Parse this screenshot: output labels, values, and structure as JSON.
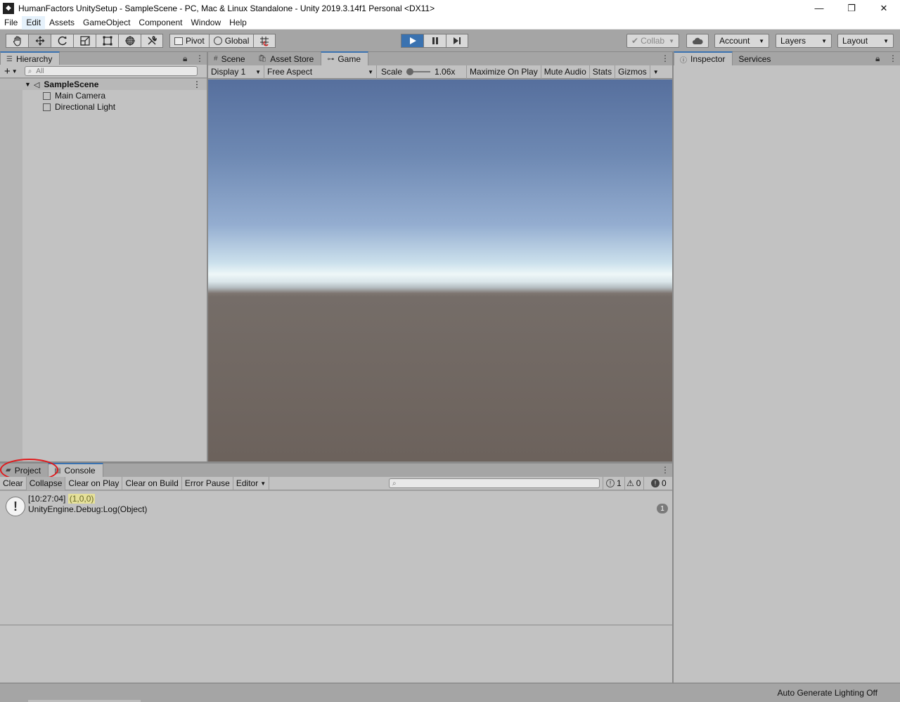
{
  "window": {
    "title": "HumanFactors UnitySetup - SampleScene - PC, Mac & Linux Standalone - Unity 2019.3.14f1 Personal <DX11>",
    "controls": {
      "minimize": "—",
      "restore": "❐",
      "close": "✕"
    }
  },
  "menu": {
    "items": [
      "File",
      "Edit",
      "Assets",
      "GameObject",
      "Component",
      "Window",
      "Help"
    ]
  },
  "toolbar": {
    "pivot_label": "Pivot",
    "global_label": "Global",
    "collab_label": "Collab",
    "account_label": "Account",
    "layers_label": "Layers",
    "layout_label": "Layout"
  },
  "hierarchy": {
    "tab_label": "Hierarchy",
    "search_placeholder": "All",
    "scene_name": "SampleScene",
    "objects": [
      "Main Camera",
      "Directional Light"
    ]
  },
  "center_tabs": {
    "scene": "Scene",
    "asset_store": "Asset Store",
    "game": "Game"
  },
  "game_toolbar": {
    "display": "Display 1",
    "aspect": "Free Aspect",
    "scale_label": "Scale",
    "scale_value": "1.06x",
    "maximize_on_play": "Maximize On Play",
    "mute_audio": "Mute Audio",
    "stats": "Stats",
    "gizmos": "Gizmos"
  },
  "right_tabs": {
    "inspector": "Inspector",
    "services": "Services"
  },
  "bottom_tabs": {
    "project": "Project",
    "console": "Console"
  },
  "console": {
    "clear": "Clear",
    "collapse": "Collapse",
    "clear_on_play": "Clear on Play",
    "clear_on_build": "Clear on Build",
    "error_pause": "Error Pause",
    "editor": "Editor",
    "info_count": "1",
    "warning_count": "0",
    "error_count": "0",
    "log": {
      "timestamp": "[10:27:04]",
      "message": "(1,0,0)",
      "detail": "UnityEngine.Debug:Log(Object)",
      "count": "1"
    }
  },
  "status": {
    "text": "Auto Generate Lighting Off"
  },
  "colors": {
    "accent": "#3a72b0",
    "panel": "#c2c2c2",
    "annotation": "#e0191b",
    "log_highlight": "#e5e09a"
  }
}
